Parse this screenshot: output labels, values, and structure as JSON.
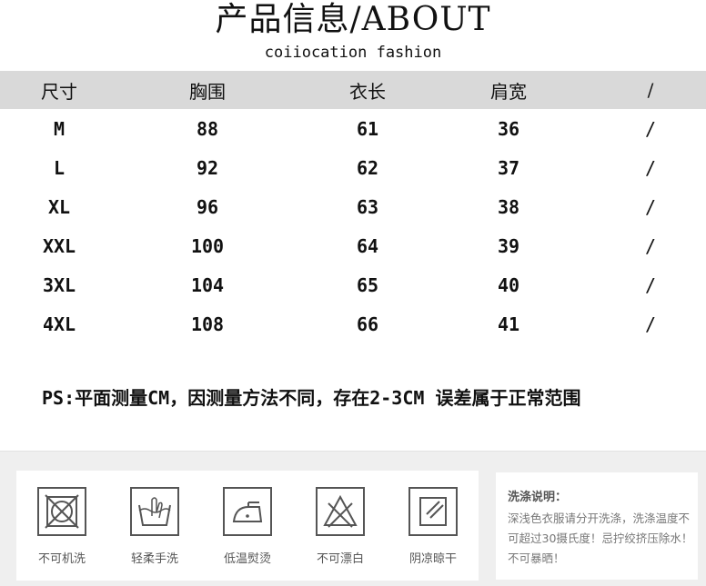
{
  "title": "产品信息/ABOUT",
  "subtitle": "coiiocation fashion",
  "table": {
    "headers": [
      "尺寸",
      "胸围",
      "衣长",
      "肩宽",
      "/"
    ],
    "rows": [
      [
        "M",
        "88",
        "61",
        "36",
        "/"
      ],
      [
        "L",
        "92",
        "62",
        "37",
        "/"
      ],
      [
        "XL",
        "96",
        "63",
        "38",
        "/"
      ],
      [
        "XXL",
        "100",
        "64",
        "39",
        "/"
      ],
      [
        "3XL",
        "104",
        "65",
        "40",
        "/"
      ],
      [
        "4XL",
        "108",
        "66",
        "41",
        "/"
      ]
    ]
  },
  "note": "PS:平面测量CM，因测量方法不同，存在2-3CM 误差属于正常范围",
  "care": {
    "icons": [
      {
        "icon": "no-machine-wash-icon",
        "label": "不可机洗"
      },
      {
        "icon": "gentle-hand-wash-icon",
        "label": "轻柔手洗"
      },
      {
        "icon": "low-temp-iron-icon",
        "label": "低温熨烫"
      },
      {
        "icon": "no-bleach-icon",
        "label": "不可漂白"
      },
      {
        "icon": "shade-dry-icon",
        "label": "阴凉晾干"
      }
    ],
    "wash_title": "洗涤说明：",
    "wash_text": "深浅色衣服请分开洗涤，洗涤温度不可超过30摄氏度！忌拧绞挤压除水！不可暴晒！"
  },
  "colors": {
    "header_bg": "#d9d9d9",
    "panel_bg": "#efefef",
    "icon_stroke": "#555555"
  }
}
